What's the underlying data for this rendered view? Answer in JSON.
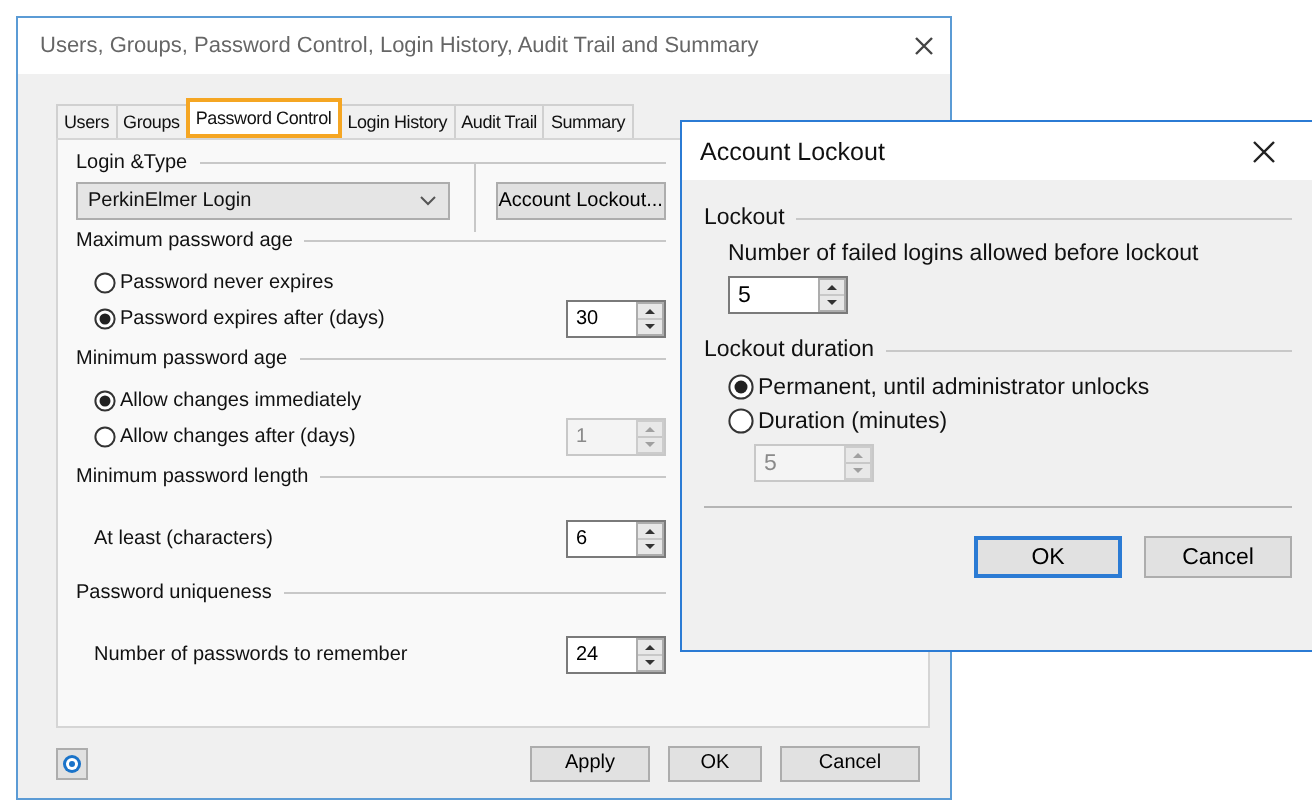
{
  "main_window": {
    "title": "Users, Groups, Password Control, Login History, Audit Trail and Summary",
    "tabs": [
      {
        "label": "Users",
        "selected": false
      },
      {
        "label": "Groups",
        "selected": false
      },
      {
        "label": "Password Control",
        "selected": true
      },
      {
        "label": "Login History",
        "selected": false
      },
      {
        "label": "Audit Trail",
        "selected": false
      },
      {
        "label": "Summary",
        "selected": false
      }
    ],
    "login_type": {
      "label": "Login &Type",
      "dropdown": "PerkinElmer Login",
      "button": "Account Lockout..."
    },
    "sections": [
      {
        "title": "Maximum password age",
        "rows": [
          {
            "kind": "radio",
            "label": "Password never expires",
            "selected": false
          },
          {
            "kind": "radio",
            "label": "Password expires after (days)",
            "selected": true,
            "spin": {
              "value": "30",
              "disabled": false
            }
          }
        ]
      },
      {
        "title": "Minimum password age",
        "rows": [
          {
            "kind": "radio",
            "label": "Allow changes immediately",
            "selected": true
          },
          {
            "kind": "radio",
            "label": "Allow changes after (days)",
            "selected": false,
            "spin": {
              "value": "1",
              "disabled": true
            }
          }
        ]
      },
      {
        "title": "Minimum password length",
        "rows": [
          {
            "kind": "text",
            "label": "At least (characters)",
            "spin": {
              "value": "6",
              "disabled": false
            }
          }
        ]
      },
      {
        "title": "Password uniqueness",
        "rows": [
          {
            "kind": "text",
            "label": "Number of passwords to remember",
            "spin": {
              "value": "24",
              "disabled": false
            }
          }
        ]
      }
    ],
    "buttons": [
      "Apply",
      "OK",
      "Cancel"
    ]
  },
  "lockout_dialog": {
    "title": "Account Lockout",
    "sections": [
      {
        "title": "Lockout",
        "rows": [
          {
            "kind": "text",
            "label": "Number of failed logins allowed before lockout"
          },
          {
            "kind": "spin",
            "spin": {
              "value": "5",
              "disabled": false
            }
          }
        ]
      },
      {
        "title": "Lockout duration",
        "rows": [
          {
            "kind": "radio",
            "label": "Permanent, until administrator unlocks",
            "selected": true
          },
          {
            "kind": "radio",
            "label": "Duration (minutes)",
            "selected": false
          },
          {
            "kind": "spin",
            "spin": {
              "value": "5",
              "disabled": true
            }
          }
        ]
      }
    ],
    "buttons": [
      {
        "label": "OK",
        "default": true
      },
      {
        "label": "Cancel",
        "default": false
      }
    ]
  }
}
